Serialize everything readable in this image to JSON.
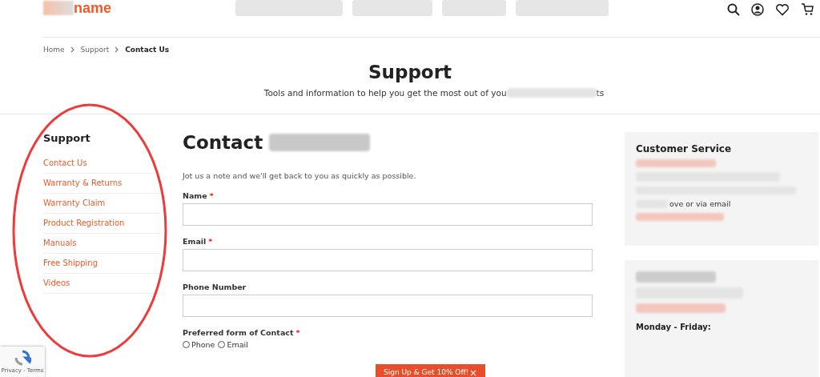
{
  "header": {
    "logo": "name"
  },
  "breadcrumb": [
    {
      "label": "Home",
      "current": false
    },
    {
      "label": "Support",
      "current": false
    },
    {
      "label": "Contact Us",
      "current": true
    }
  ],
  "page": {
    "title": "Support",
    "subtitle": "Tools and information to help you get the most out of you",
    "subtitle_end": "ts"
  },
  "sidebar": {
    "title": "Support",
    "items": [
      {
        "label": "Contact Us"
      },
      {
        "label": "Warranty & Returns"
      },
      {
        "label": "Warranty Claim"
      },
      {
        "label": "Product Registration"
      },
      {
        "label": "Manuals"
      },
      {
        "label": "Free Shipping"
      },
      {
        "label": "Videos"
      }
    ]
  },
  "form": {
    "title": "Contact",
    "intro": "Jot us a note and we'll get back to you as quickly as possible.",
    "fields": [
      {
        "label": "Name",
        "required_mark": "*"
      },
      {
        "label": "Email",
        "required_mark": "*"
      },
      {
        "label": "Phone Number"
      }
    ],
    "preferred": {
      "label": "Preferred form of Contact",
      "required_mark": "*",
      "options": [
        {
          "label": "Phone",
          "selected": false
        },
        {
          "label": "Email",
          "selected": false
        }
      ]
    }
  },
  "customer_service": {
    "title": "Customer Service",
    "text": "ove or via email"
  },
  "hours": {
    "label": "Monday - Friday:"
  },
  "popup": {
    "label": "Sign Up & Get 10% Off!",
    "close": "×"
  },
  "recaptcha": {
    "label": "Privacy - Terms"
  }
}
